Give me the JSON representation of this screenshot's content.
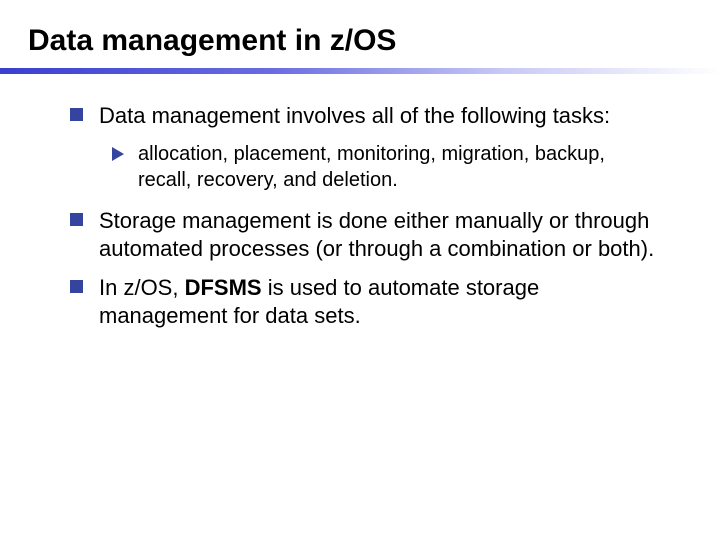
{
  "title": "Data management in z/OS",
  "bullets": {
    "b0": "Data management involves all of the following tasks:",
    "b0_sub0": "allocation, placement, monitoring, migration, backup, recall, recovery, and deletion.",
    "b1": "Storage management is done either manually or through automated processes (or through a combination or both).",
    "b2_pre": "In z/OS, ",
    "b2_bold": "DFSMS",
    "b2_post": " is used to automate storage management for data sets."
  }
}
